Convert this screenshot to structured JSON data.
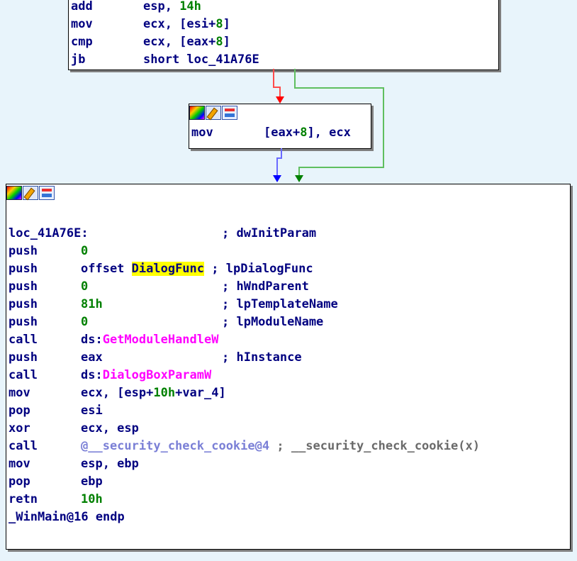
{
  "top_block": {
    "lines": [
      {
        "mnemonic": "add",
        "operands": "esp, ",
        "imm": "14h"
      },
      {
        "mnemonic": "mov",
        "operands": "ecx, [esi+",
        "imm": "8",
        "tail": "]"
      },
      {
        "mnemonic": "cmp",
        "operands": "ecx, [eax+",
        "imm": "8",
        "tail": "]"
      },
      {
        "mnemonic": "jb",
        "operands": "short loc_41A76E"
      }
    ]
  },
  "middle_block": {
    "lines": [
      {
        "mnemonic": "mov",
        "operands": "[eax+",
        "imm": "8",
        "tail": "], ecx"
      }
    ]
  },
  "main_block": {
    "label_line": {
      "label": "loc_41A76E:",
      "comment": "; dwInitParam"
    },
    "lines": [
      {
        "mnemonic": "push",
        "imm": "0",
        "comment": ""
      },
      {
        "mnemonic": "push",
        "pre": "offset ",
        "highlight": "DialogFunc",
        "comment": "; lpDialogFunc"
      },
      {
        "mnemonic": "push",
        "imm": "0",
        "comment": "; hWndParent"
      },
      {
        "mnemonic": "push",
        "imm": "81h",
        "comment": "; lpTemplateName"
      },
      {
        "mnemonic": "push",
        "imm": "0",
        "comment": "; lpModuleName"
      },
      {
        "mnemonic": "call",
        "pre": "ds:",
        "api": "GetModuleHandleW",
        "comment": ""
      },
      {
        "mnemonic": "push",
        "operands": "eax",
        "comment": "; hInstance"
      },
      {
        "mnemonic": "call",
        "pre": "ds:",
        "api": "DialogBoxParamW",
        "comment": ""
      },
      {
        "mnemonic": "mov",
        "operands": "ecx, [esp+",
        "imm": "10h",
        "tail": "+var_4]"
      },
      {
        "mnemonic": "pop",
        "operands": "esi"
      },
      {
        "mnemonic": "xor",
        "operands": "ecx, esp"
      },
      {
        "mnemonic": "call",
        "faded": "@__security_check_cookie@4",
        "comment": "; __security_check_cookie(x)"
      },
      {
        "mnemonic": "mov",
        "operands": "esp, ebp"
      },
      {
        "mnemonic": "pop",
        "operands": "ebp"
      },
      {
        "mnemonic": "retn",
        "imm": "10h"
      }
    ],
    "endp": "_WinMain@16 endp"
  },
  "icons": [
    "colors-icon",
    "edit-icon",
    "graph-icon"
  ],
  "colors": {
    "background": "#e8f4fb",
    "text": "#000080",
    "immediate": "#008000",
    "api": "#ff00ff",
    "highlight": "#ffff00",
    "edge_true": "#ff0000",
    "edge_false": "#00aa00",
    "edge_uncond": "#4040ff"
  }
}
